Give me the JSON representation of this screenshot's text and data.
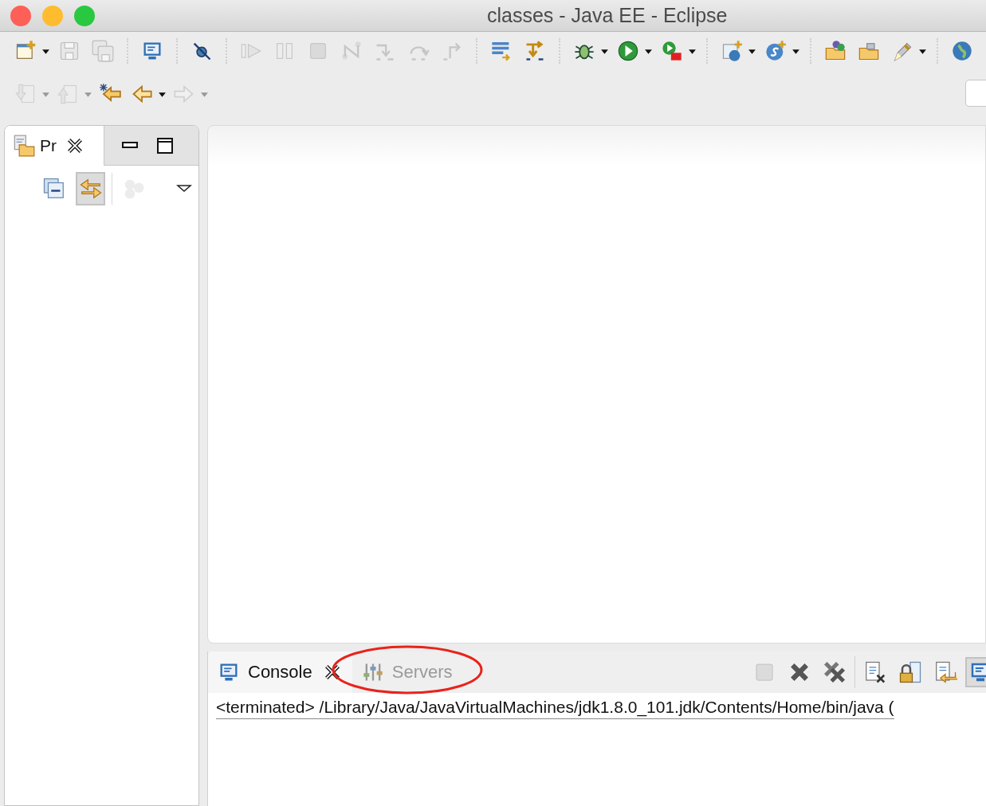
{
  "window": {
    "title": "classes - Java EE - Eclipse",
    "buttons": [
      {
        "kind": "close"
      },
      {
        "kind": "minimize"
      },
      {
        "kind": "zoom"
      }
    ]
  },
  "main_toolbar": [
    [
      {
        "kind": "new-window",
        "disabled": false,
        "dropdown": true
      },
      {
        "kind": "save",
        "disabled": true,
        "dropdown": false
      },
      {
        "kind": "save-all",
        "disabled": true,
        "dropdown": false
      }
    ],
    [
      {
        "kind": "monitor",
        "disabled": false,
        "dropdown": false
      }
    ],
    [
      {
        "kind": "skip",
        "disabled": false,
        "dropdown": false
      }
    ],
    [
      {
        "kind": "resume",
        "disabled": true,
        "dropdown": false
      },
      {
        "kind": "suspend",
        "disabled": true,
        "dropdown": false
      },
      {
        "kind": "terminate",
        "disabled": true,
        "dropdown": false
      },
      {
        "kind": "disconnect",
        "disabled": true,
        "dropdown": false
      },
      {
        "kind": "step-into",
        "disabled": true,
        "dropdown": false
      },
      {
        "kind": "step-over",
        "disabled": true,
        "dropdown": false
      },
      {
        "kind": "step-return",
        "disabled": true,
        "dropdown": false
      }
    ],
    [
      {
        "kind": "lines-arrow",
        "disabled": false,
        "dropdown": false
      },
      {
        "kind": "filter",
        "disabled": false,
        "dropdown": false
      }
    ],
    [
      {
        "kind": "bug",
        "disabled": false,
        "dropdown": true
      },
      {
        "kind": "run",
        "disabled": false,
        "dropdown": true
      },
      {
        "kind": "run-tools",
        "disabled": false,
        "dropdown": true
      }
    ],
    [
      {
        "kind": "web-window",
        "disabled": false,
        "dropdown": true
      },
      {
        "kind": "service",
        "disabled": false,
        "dropdown": true
      }
    ],
    [
      {
        "kind": "folder-people",
        "disabled": false,
        "dropdown": false
      },
      {
        "kind": "folder-case",
        "disabled": false,
        "dropdown": false
      },
      {
        "kind": "pen",
        "disabled": false,
        "dropdown": true
      }
    ],
    [
      {
        "kind": "globe",
        "disabled": false,
        "dropdown": false
      }
    ]
  ],
  "nav_toolbar": [
    {
      "kind": "ann-down",
      "disabled": true,
      "dropdown": true
    },
    {
      "kind": "ann-up",
      "disabled": true,
      "dropdown": true
    },
    {
      "kind": "last-edit",
      "disabled": false,
      "dropdown": false
    },
    {
      "kind": "back",
      "disabled": false,
      "dropdown": true
    },
    {
      "kind": "forward",
      "disabled": true,
      "dropdown": true
    }
  ],
  "project_explorer": {
    "tab": {
      "label": "Pr",
      "selected": true
    },
    "tools": [
      {
        "kind": "collapse",
        "pressed": false,
        "disabled": false
      },
      {
        "kind": "link",
        "pressed": true,
        "disabled": false
      },
      {
        "kind": "balls",
        "pressed": false,
        "disabled": true
      },
      {
        "kind": "view-menu",
        "pressed": false,
        "disabled": false
      }
    ]
  },
  "console_view": {
    "tabs": [
      {
        "label": "Console",
        "kind": "console",
        "selected": true,
        "highlighted": false
      },
      {
        "label": "Servers",
        "kind": "servers",
        "selected": false,
        "highlighted": true
      }
    ],
    "tools": [
      {
        "kind": "terminate",
        "pressed": false,
        "disabled": true
      },
      {
        "kind": "remove",
        "pressed": false,
        "disabled": false
      },
      {
        "kind": "remove-all",
        "pressed": false,
        "disabled": false
      },
      {
        "kind": "page-x",
        "pressed": false,
        "disabled": false
      },
      {
        "kind": "lock",
        "pressed": false,
        "disabled": false
      },
      {
        "kind": "page-arrow",
        "pressed": false,
        "disabled": false
      },
      {
        "kind": "monitor",
        "pressed": true,
        "disabled": false
      }
    ],
    "process_label": "<terminated> /Library/Java/JavaVirtualMachines/jdk1.8.0_101.jdk/Contents/Home/bin/java ("
  }
}
